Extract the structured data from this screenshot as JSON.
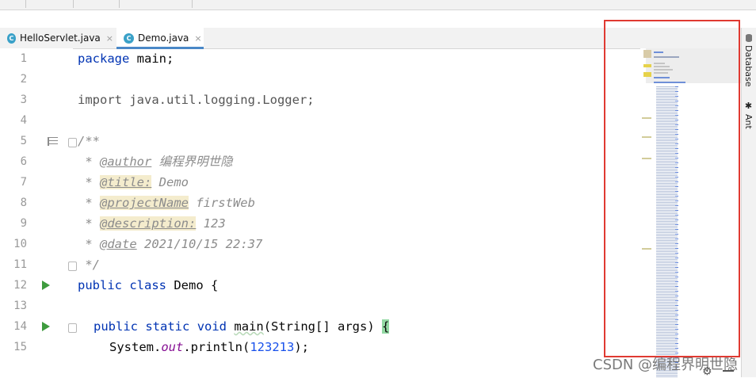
{
  "tabs": [
    {
      "label": "HelloServlet.java",
      "icon": "class-icon",
      "icon_letter": "C",
      "close": "×",
      "active": false
    },
    {
      "label": "Demo.java",
      "icon": "class-icon",
      "icon_letter": "C",
      "close": "×",
      "active": true
    }
  ],
  "gutter": {
    "line_numbers": [
      "1",
      "2",
      "3",
      "4",
      "5",
      "6",
      "7",
      "8",
      "9",
      "10",
      "11",
      "12",
      "13",
      "14",
      "15"
    ]
  },
  "code": {
    "l1_kw": "package",
    "l1_rest": " main;",
    "l3_kw": "import",
    "l3_rest": " java.util.logging.Logger;",
    "l5": "/**",
    "l6_star": " * ",
    "l6_tag": "@author",
    "l6_val": " 编程界明世隐",
    "l7_star": " * ",
    "l7_tag": "@title:",
    "l7_val": " Demo",
    "l8_star": " * ",
    "l8_tag": "@projectName",
    "l8_val": " firstWeb",
    "l9_star": " * ",
    "l9_tag": "@description:",
    "l9_val": " 123",
    "l10_star": " * ",
    "l10_tag": "@date",
    "l10_val": " 2021/10/15 22:37",
    "l11": " */",
    "l12_kw1": "public",
    "l12_kw2": "class",
    "l12_rest": " Demo {",
    "l14_kw1": "public",
    "l14_kw2": "static",
    "l14_kw3": "void",
    "l14_method": "main",
    "l14_rest": "(String[] args) ",
    "l14_brace": "{",
    "l15_a": "System.",
    "l15_field": "out",
    "l15_b": ".println(",
    "l15_num": "123213",
    "l15_c": ");"
  },
  "right_toolbar": {
    "database_label": "Database",
    "ant_label": "Ant"
  },
  "watermark": "CSDN @编程界明世隐",
  "colors": {
    "keyword": "#0033b3",
    "comment": "#8c8c8c",
    "number": "#1750eb",
    "highlight_box": "#e03a32"
  }
}
